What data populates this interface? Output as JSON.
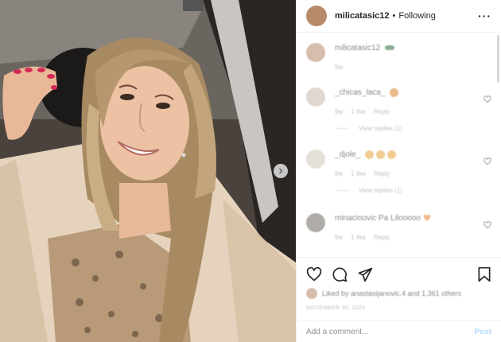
{
  "colors": {
    "text": "#262626",
    "muted": "#8e8e8e",
    "border": "#efefef",
    "post_button": "#b3dbff",
    "heart_emoji": "#e67e22"
  },
  "header": {
    "username": "milicatasic12",
    "separator": "•",
    "follow_status": "Following",
    "more_icon": "more-horizontal-icon"
  },
  "comments": [
    {
      "username": "milicatasic12",
      "text": "",
      "meta": [
        "9w"
      ],
      "emoji": "green-heart"
    },
    {
      "username": "_chicas_laca_",
      "text": "",
      "meta": [
        "9w",
        "1 like",
        "Reply"
      ],
      "emoji": "smile",
      "replies": "View replies (1)"
    },
    {
      "username": "_djole_",
      "text": "",
      "meta": [
        "9w",
        "1 like",
        "Reply"
      ],
      "emoji": "smile x3",
      "replies": "View replies (1)"
    },
    {
      "username": "minacinovic",
      "text": "Pa Lilooooo",
      "meta": [
        "9w",
        "1 like",
        "Reply"
      ],
      "emoji": "orange-heart"
    }
  ],
  "actions": {
    "like_icon": "heart-icon",
    "comment_icon": "comment-icon",
    "share_icon": "paper-plane-icon",
    "save_icon": "bookmark-icon"
  },
  "likes": {
    "text": "Liked by anastasijanovic.4 and 1,361 others"
  },
  "date": "NOVEMBER 30, 2020",
  "add_comment": {
    "placeholder": "Add a comment...",
    "post_label": "Post"
  }
}
